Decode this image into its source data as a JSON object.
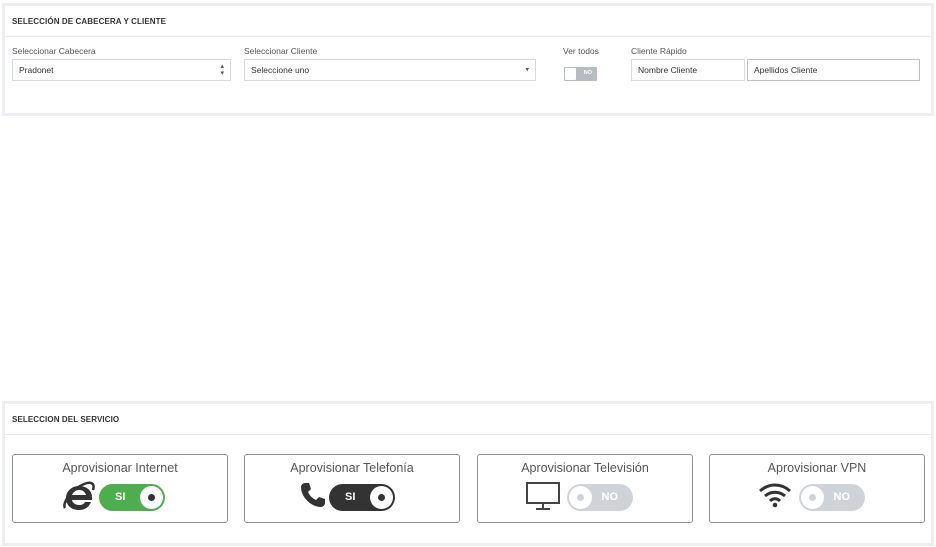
{
  "header_section": {
    "title": "SELECCIÓN DE CABECERA Y CLIENTE",
    "cabecera_label": "Seleccionar Cabecera",
    "cabecera_value": "Pradonet",
    "cliente_label": "Seleccionar Cliente",
    "cliente_value": "Seleccione uno",
    "ver_todos_label": "Ver todos",
    "ver_todos_state": "NO",
    "cliente_rapido_label": "Cliente Rápido",
    "nombre_placeholder": "Nombre Cliente",
    "apellidos_placeholder": "Apellidos Cliente"
  },
  "service_section": {
    "title": "SELECCION DEL SERVICIO",
    "services": [
      {
        "label": "Aprovisionar Internet",
        "icon": "internet-explorer-icon",
        "state": "SI",
        "color": "#4cae4c"
      },
      {
        "label": "Aprovisionar Telefonía",
        "icon": "phone-icon",
        "state": "SI",
        "color": "#333333"
      },
      {
        "label": "Aprovisionar Televisión",
        "icon": "monitor-icon",
        "state": "NO",
        "color": "#cfd3d7"
      },
      {
        "label": "Aprovisionar VPN",
        "icon": "wifi-icon",
        "state": "NO",
        "color": "#cfd3d7"
      }
    ]
  }
}
